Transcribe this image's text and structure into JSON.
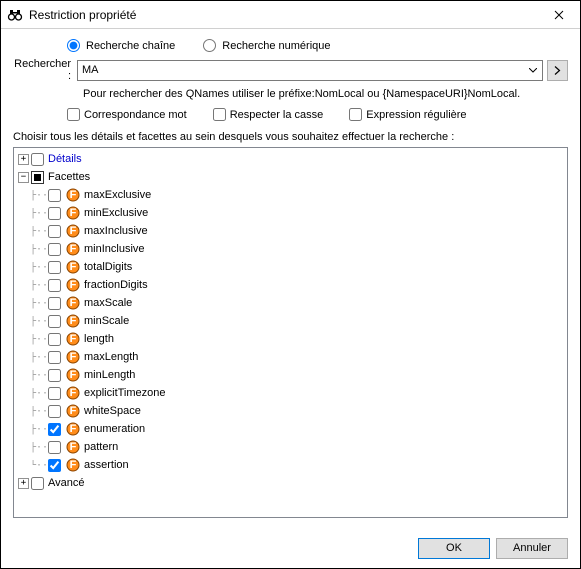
{
  "window": {
    "title": "Restriction propriété"
  },
  "search": {
    "mode_string": "Recherche chaîne",
    "mode_numeric": "Recherche numérique",
    "label": "Rechercher :",
    "value": "MA",
    "hint": "Pour rechercher des QNames utiliser le préfixe:NomLocal ou {NamespaceURI}NomLocal.",
    "match_word": "Correspondance mot",
    "match_case": "Respecter la casse",
    "regex": "Expression régulière"
  },
  "tree": {
    "prompt": "Choisir tous les détails et facettes au sein desquels vous souhaitez effectuer la recherche :",
    "details": "Détails",
    "facets": "Facettes",
    "advanced": "Avancé",
    "items": [
      {
        "label": "maxExclusive",
        "checked": false
      },
      {
        "label": "minExclusive",
        "checked": false
      },
      {
        "label": "maxInclusive",
        "checked": false
      },
      {
        "label": "minInclusive",
        "checked": false
      },
      {
        "label": "totalDigits",
        "checked": false
      },
      {
        "label": "fractionDigits",
        "checked": false
      },
      {
        "label": "maxScale",
        "checked": false
      },
      {
        "label": "minScale",
        "checked": false
      },
      {
        "label": "length",
        "checked": false
      },
      {
        "label": "maxLength",
        "checked": false
      },
      {
        "label": "minLength",
        "checked": false
      },
      {
        "label": "explicitTimezone",
        "checked": false
      },
      {
        "label": "whiteSpace",
        "checked": false
      },
      {
        "label": "enumeration",
        "checked": true
      },
      {
        "label": "pattern",
        "checked": false
      },
      {
        "label": "assertion",
        "checked": true
      }
    ]
  },
  "buttons": {
    "ok": "OK",
    "cancel": "Annuler"
  },
  "chart_data": null
}
